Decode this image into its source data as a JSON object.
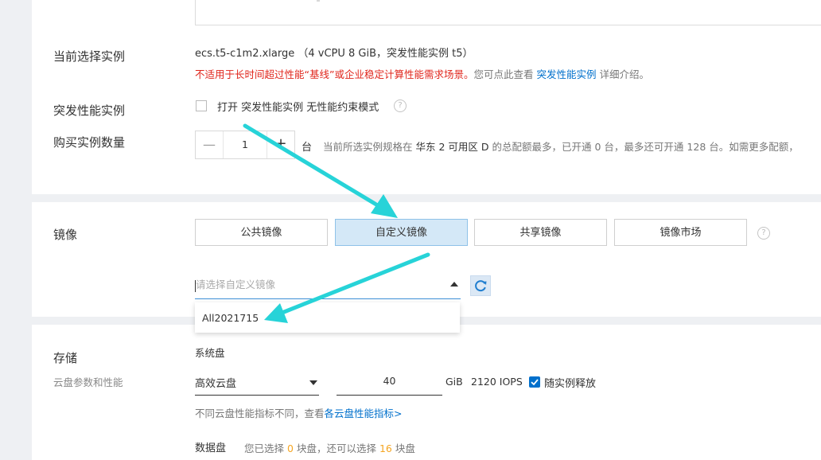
{
  "instance": {
    "label": "当前选择实例",
    "spec": "ecs.t5-c1m2.xlarge （4 vCPU 8 GiB，突发性能实例 t5）",
    "warning_red": "不适用于长时间超过性能“基线”或企业稳定计算性能需求场景。",
    "warning_gray": "您可点此查看",
    "warning_link": "突发性能实例",
    "warning_tail": "详细介绍。"
  },
  "burst": {
    "label": "突发性能实例",
    "option_text": "打开 突发性能实例 无性能约束模式"
  },
  "quantity": {
    "label": "购买实例数量",
    "minus": "—",
    "value": "1",
    "plus": "+",
    "unit": "台",
    "note_prefix": "当前所选实例规格在",
    "region": "华东 2 可用区 D",
    "note_mid1": "的总配额最多，已开通",
    "opened": "0",
    "note_mid2": "台，最多还可开通",
    "remaining": "128",
    "note_tail": "台。如需更多配额，"
  },
  "image": {
    "label": "镜像",
    "tabs": [
      {
        "label": "公共镜像",
        "active": false
      },
      {
        "label": "自定义镜像",
        "active": true
      },
      {
        "label": "共享镜像",
        "active": false
      },
      {
        "label": "镜像市场",
        "active": false
      }
    ],
    "select_placeholder": "请选择自定义镜像",
    "dropdown_option": "All2021715"
  },
  "storage": {
    "label": "存储",
    "sub_label": "云盘参数和性能",
    "system_disk_label": "系统盘",
    "disk_type": "高效云盘",
    "disk_size": "40",
    "unit": "GiB",
    "iops": "2120 IOPS",
    "release_label": "随实例释放",
    "perf_note": "不同云盘性能指标不同，查看",
    "perf_link": "各云盘性能指标>",
    "data_disk_label": "数据盘",
    "data_note1": "您已选择",
    "data_selected": "0",
    "data_note2": "块盘，还可以选择",
    "data_remaining": "16",
    "data_note3": "块盘"
  },
  "colors": {
    "accent": "#0070cc",
    "arrow": "#27d3d8",
    "warning": "#e0261c",
    "orange": "#f5a623"
  }
}
